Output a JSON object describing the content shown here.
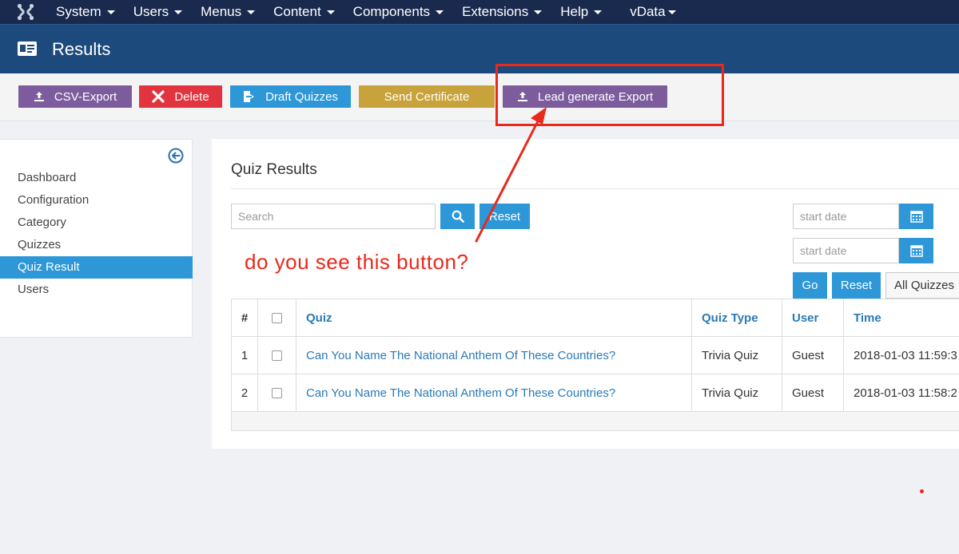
{
  "navbar": {
    "items": [
      {
        "label": "System"
      },
      {
        "label": "Users"
      },
      {
        "label": "Menus"
      },
      {
        "label": "Content"
      },
      {
        "label": "Components"
      },
      {
        "label": "Extensions"
      },
      {
        "label": "Help"
      }
    ],
    "extra": {
      "label": "vData"
    }
  },
  "header": {
    "title": "Results",
    "icon": "id-card-icon"
  },
  "toolbar": {
    "csv_export": "CSV-Export",
    "delete": "Delete",
    "draft_quizzes": "Draft Quizzes",
    "send_certificate": "Send Certificate",
    "lead_export": "Lead generate Export"
  },
  "sidebar": {
    "items": [
      {
        "label": "Dashboard"
      },
      {
        "label": "Configuration"
      },
      {
        "label": "Category"
      },
      {
        "label": "Quizzes"
      },
      {
        "label": "Quiz Result",
        "active": true
      },
      {
        "label": "Users"
      }
    ]
  },
  "main": {
    "title": "Quiz Results",
    "search": {
      "placeholder": "Search",
      "value": ""
    },
    "reset_label": "Reset",
    "filters": {
      "start_date_1": {
        "placeholder": "start date"
      },
      "start_date_2": {
        "placeholder": "start date"
      },
      "go_label": "Go",
      "reset_label": "Reset",
      "quiz_select": "All Quizzes"
    },
    "table": {
      "headers": [
        "#",
        "",
        "Quiz",
        "Quiz Type",
        "User",
        "Time"
      ],
      "rows": [
        {
          "num": "1",
          "quiz": "Can You Name The National Anthem Of These Countries?",
          "type": "Trivia Quiz",
          "user": "Guest",
          "time": "2018-01-03 11:59:3"
        },
        {
          "num": "2",
          "quiz": "Can You Name The National Anthem Of These Countries?",
          "type": "Trivia Quiz",
          "user": "Guest",
          "time": "2018-01-03 11:58:2"
        }
      ]
    }
  },
  "annotation": {
    "text": "do you see this button?",
    "color": "#e8291c"
  },
  "colors": {
    "navbar": "#1a2a4e",
    "header": "#1d4a7c",
    "primary": "#2d97d8",
    "purple": "#7d5c9e",
    "danger": "#e1343f",
    "gold": "#c8a23a"
  }
}
